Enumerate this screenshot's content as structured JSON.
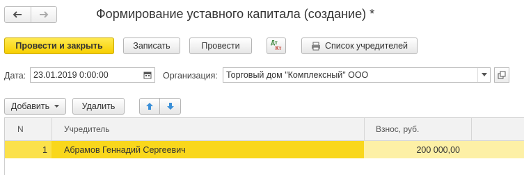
{
  "window": {
    "title": "Формирование уставного капитала (создание) *",
    "nav_back_icon": "arrow-left-icon",
    "nav_forward_icon": "arrow-right-icon"
  },
  "toolbar": {
    "post_close_label": "Провести и закрыть",
    "save_label": "Записать",
    "post_label": "Провести",
    "dtkt_top": "Дт",
    "dtkt_bottom": "Кт",
    "founders_list_label": "Список учредителей"
  },
  "form": {
    "date_label": "Дата:",
    "date_value": "23.01.2019  0:00:00",
    "org_label": "Организация:",
    "org_value": "Торговый дом \"Комплексный\" ООО"
  },
  "table_toolbar": {
    "add_label": "Добавить",
    "delete_label": "Удалить"
  },
  "table": {
    "columns": [
      "N",
      "Учредитель",
      "Взнос, руб."
    ],
    "rows": [
      {
        "n": "1",
        "founder": "Абрамов Геннадий Сергеевич",
        "amount": "200 000,00"
      }
    ]
  },
  "colors": {
    "primary": "#f7cf00",
    "row_selected": "#fbe14b",
    "row_selected_light": "#fdf1a8"
  }
}
